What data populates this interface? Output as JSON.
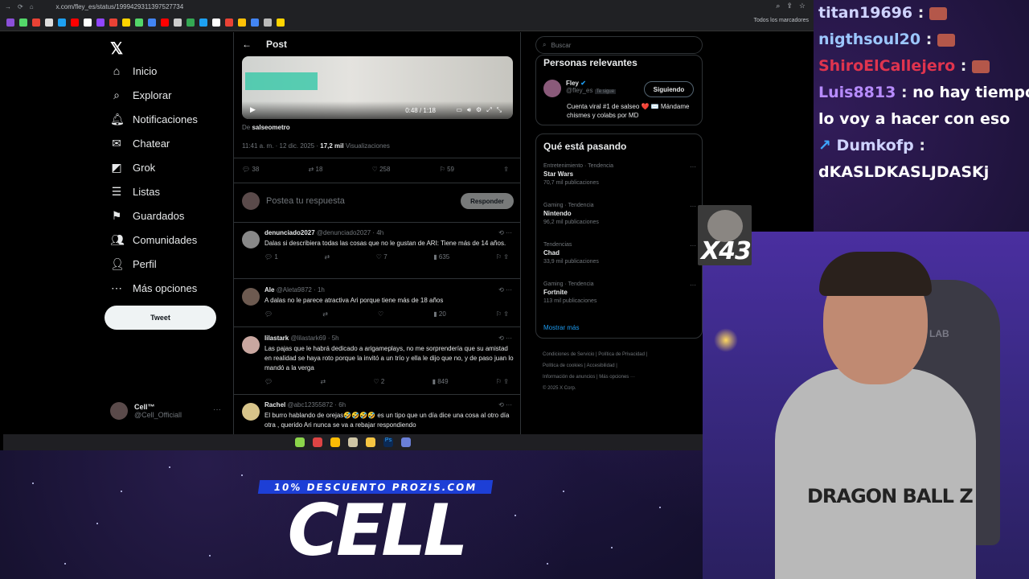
{
  "browser": {
    "url": "x.com/fley_es/status/1999429311397527734",
    "bookmarks_label": "Todos los marcadores"
  },
  "sidebar": {
    "items": [
      {
        "label": "Inicio",
        "icon": "home-icon"
      },
      {
        "label": "Explorar",
        "icon": "search-icon"
      },
      {
        "label": "Notificaciones",
        "icon": "bell-icon"
      },
      {
        "label": "Chatear",
        "icon": "mail-icon"
      },
      {
        "label": "Grok",
        "icon": "grok-icon"
      },
      {
        "label": "Listas",
        "icon": "list-icon"
      },
      {
        "label": "Guardados",
        "icon": "bookmark-icon"
      },
      {
        "label": "Comunidades",
        "icon": "people-icon"
      },
      {
        "label": "Perfil",
        "icon": "person-icon"
      },
      {
        "label": "Más opciones",
        "icon": "more-icon"
      }
    ],
    "tweet_button": "Tweet",
    "account": {
      "name": "Cell™",
      "handle": "@Cell_Officiall"
    }
  },
  "post": {
    "header": "Post",
    "video_time": "0:48 / 1:18",
    "from_prefix": "De",
    "from_account": "salseometro",
    "timestamp": "11:41 a. m. · 12 dic. 2025 ·",
    "views": "17,2 mil",
    "views_label": "Visualizaciones",
    "stats": {
      "replies": "38",
      "reposts": "18",
      "likes": "258",
      "bookmarks": "59"
    },
    "reply_placeholder": "Postea tu respuesta",
    "reply_button": "Responder"
  },
  "replies": [
    {
      "name": "denunciado2027",
      "handle": "@denunciado2027 · 4h",
      "text": "Dalas si describiera todas las cosas que no le gustan de ARI: Tiene más de 14 años.",
      "replies": "1",
      "reposts": "",
      "likes": "7",
      "views": "635"
    },
    {
      "name": "Ale",
      "handle": "@Aleta9872 · 1h",
      "text": "A dalas no le parece atractiva Ari porque tiene más de 18 años",
      "replies": "",
      "reposts": "",
      "likes": "",
      "views": "20"
    },
    {
      "name": "lilastark",
      "handle": "@lilastark69 · 5h",
      "text": "Las pajas que le habrá dedicado a arigameplays, no me sorprendería que su amistad en realidad se haya roto porque la invitó a un trío y ella le dijo que no, y de paso juan lo mandó a la verga",
      "replies": "",
      "reposts": "",
      "likes": "2",
      "views": "849"
    },
    {
      "name": "Rachel",
      "handle": "@abc12355872 · 6h",
      "text": "El burro hablando de orejas🤣🤣🤣🤣 es un tipo que un día dice una cosa al otro día otra , querido Ari nunca se va a rebajar respondiendo",
      "replies": "",
      "reposts": "",
      "likes": "",
      "views": ""
    }
  ],
  "right": {
    "search_placeholder": "Buscar",
    "relevant_title": "Personas relevantes",
    "relevant": {
      "name": "Fley",
      "handle": "@fley_es",
      "badge": "Te sigue",
      "bio": "Cuenta viral #1 de salseo ❤️ ✉️ Mándame chismes y colabs por MD",
      "button": "Siguiendo"
    },
    "trending_title": "Qué está pasando",
    "trends": [
      {
        "category": "Entretenimiento · Tendencia",
        "title": "Star Wars",
        "count": "70,7 mil publicaciones"
      },
      {
        "category": "Gaming · Tendencia",
        "title": "Nintendo",
        "count": "96,2 mil publicaciones"
      },
      {
        "category": "Tendencias",
        "title": "Chad",
        "count": "33,9 mil publicaciones"
      },
      {
        "category": "Gaming · Tendencia",
        "title": "Fortnite",
        "count": "113 mil publicaciones"
      }
    ],
    "show_more": "Mostrar más",
    "footer": [
      "Condiciones de Servicio",
      "Política de Privacidad",
      "Política de cookies",
      "Accesibilidad",
      "Información de anuncios",
      "Más opciones ···",
      "© 2025 X Corp."
    ]
  },
  "chat": [
    {
      "user": "titan19696",
      "color": "#cfd3ff",
      "msg": ""
    },
    {
      "user": "nigthsoul20",
      "color": "#9cc7ff",
      "msg": ""
    },
    {
      "user": "ShiroElCallejero",
      "color": "#e0344e",
      "msg": ""
    },
    {
      "user": "Luis8813",
      "color": "#b78cff",
      "msg": "no hay tiempo,"
    },
    {
      "user": "",
      "color": "#ffffff",
      "msg": "lo voy a hacer con eso"
    },
    {
      "user": "Dumkofp",
      "color": "#cfd3ff",
      "msg": ""
    },
    {
      "user": "",
      "color": "#ffffff",
      "msg": "dKASLDKASLJDASKj"
    }
  ],
  "overlay": {
    "multiplier": "X43",
    "chair_brand": "SECRET LAB",
    "hoodie_text": "DRAGON BALL Z",
    "promo": "10% DESCUENTO PROZIS.COM",
    "brand": "CELL"
  }
}
